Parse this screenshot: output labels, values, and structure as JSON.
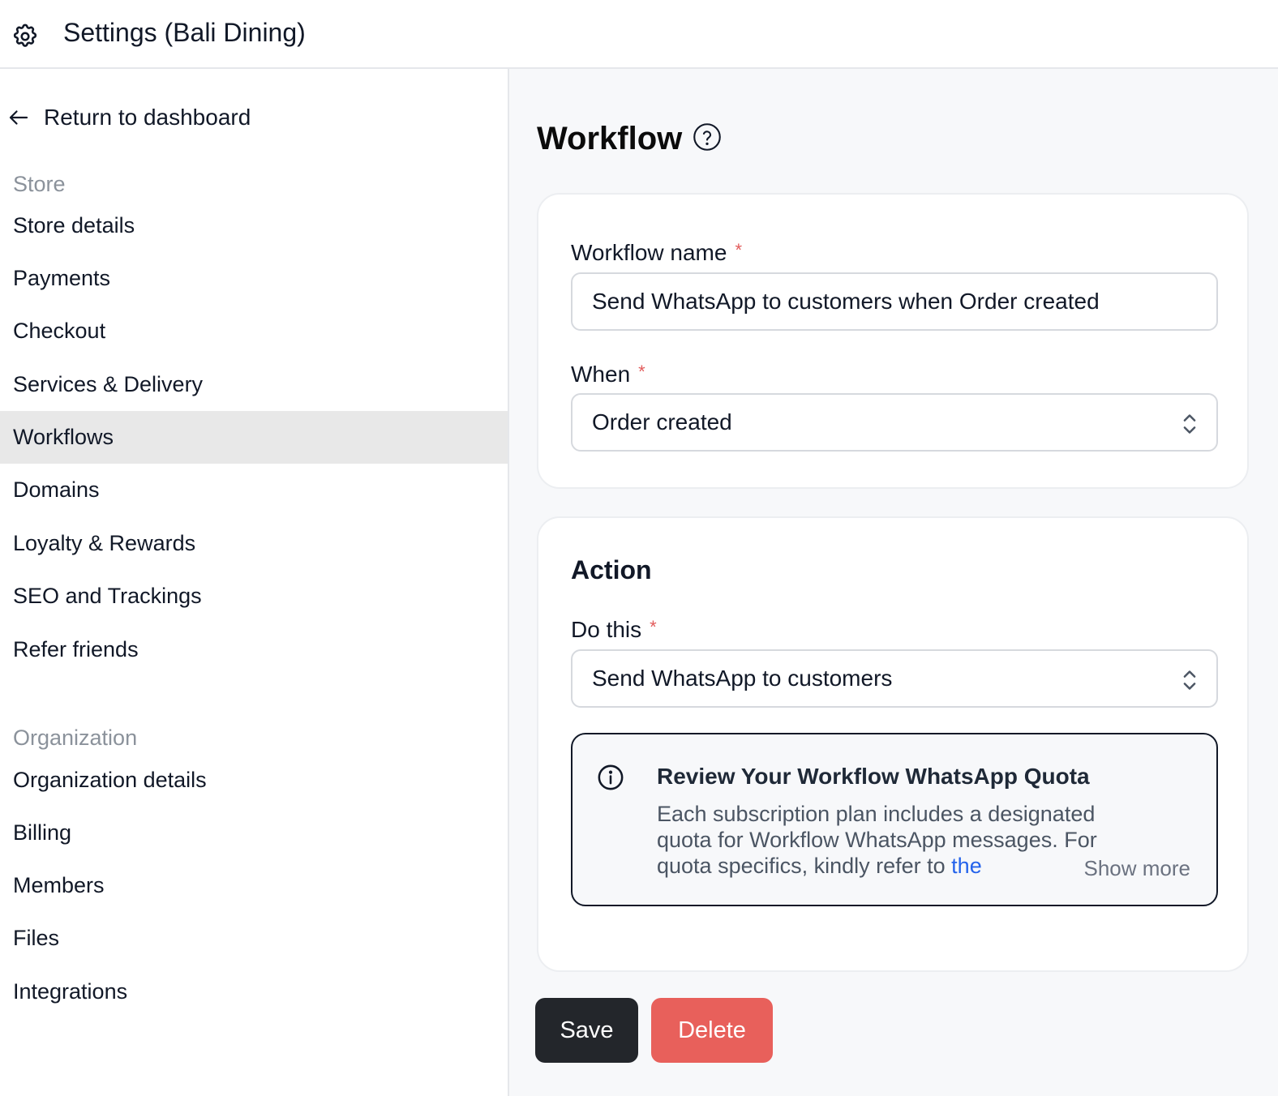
{
  "header": {
    "title": "Settings (Bali Dining)",
    "icon": "gear-icon"
  },
  "sidebar": {
    "back_label": "Return to dashboard",
    "store_section": "Store",
    "store_items": [
      {
        "label": "Store details"
      },
      {
        "label": "Payments"
      },
      {
        "label": "Checkout"
      },
      {
        "label": "Services & Delivery"
      },
      {
        "label": "Workflows",
        "active": true
      },
      {
        "label": "Domains"
      },
      {
        "label": "Loyalty & Rewards"
      },
      {
        "label": "SEO and Trackings"
      },
      {
        "label": "Refer friends"
      }
    ],
    "org_section": "Organization",
    "org_items": [
      {
        "label": "Organization details"
      },
      {
        "label": "Billing"
      },
      {
        "label": "Members"
      },
      {
        "label": "Files"
      },
      {
        "label": "Integrations"
      }
    ]
  },
  "main": {
    "title": "Workflow",
    "trigger_card": {
      "name_label": "Workflow name",
      "name_value": "Send WhatsApp to customers when Order created",
      "when_label": "When",
      "when_value": "Order created"
    },
    "action_card": {
      "title": "Action",
      "do_label": "Do this",
      "do_value": "Send WhatsApp to customers",
      "info": {
        "title": "Review Your Workflow WhatsApp Quota",
        "body": "Each subscription plan includes a designated quota for Workflow WhatsApp messages. For quota specifics, kindly refer to ",
        "link": "the",
        "show_more": "Show more"
      }
    },
    "buttons": {
      "save": "Save",
      "delete": "Delete"
    },
    "required_mark": "*"
  },
  "colors": {
    "accent_dark": "#23262b",
    "danger": "#e8605b",
    "required": "#e25b5b",
    "link": "#2563eb",
    "active_nav": "#e8e8e8"
  }
}
